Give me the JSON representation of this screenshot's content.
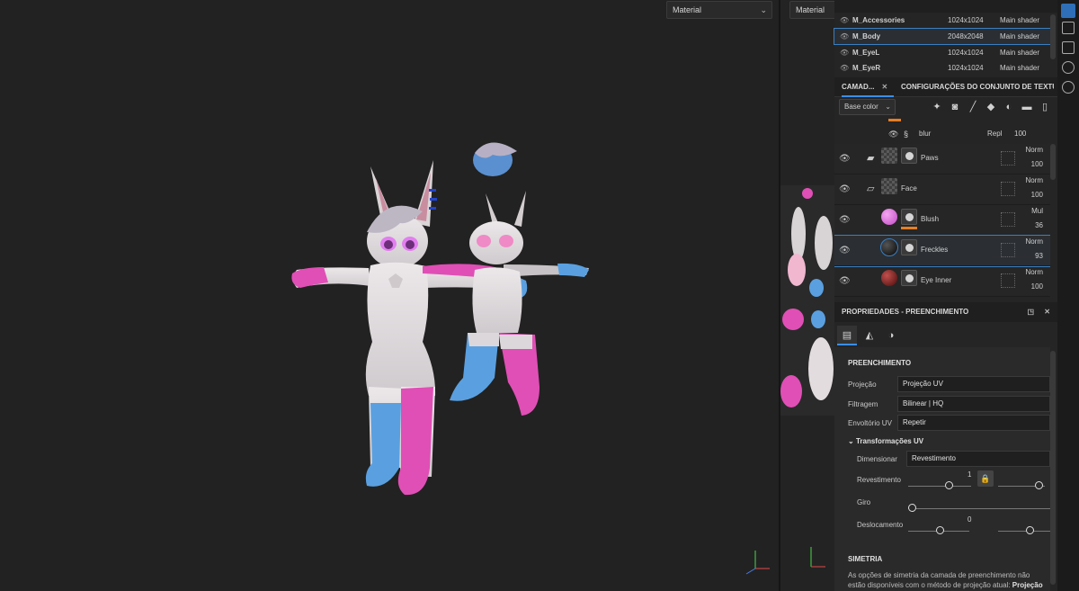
{
  "viewport3d": {
    "material_select": "Material"
  },
  "viewport2d": {
    "material_select": "Material"
  },
  "texture_sets": {
    "rows": [
      {
        "name": "M_Accessories",
        "resolution": "1024x1024",
        "shader": "Main shader",
        "selected": false
      },
      {
        "name": "M_Body",
        "resolution": "2048x2048",
        "shader": "Main shader",
        "selected": true
      },
      {
        "name": "M_EyeL",
        "resolution": "1024x1024",
        "shader": "Main shader",
        "selected": false
      },
      {
        "name": "M_EyeR",
        "resolution": "1024x1024",
        "shader": "Main shader",
        "selected": false
      }
    ]
  },
  "tabs": {
    "layers": "CAMAD...",
    "texture_set_settings": "CONFIGURAÇÕES DO CONJUNTO DE TEXTU..."
  },
  "toolbar": {
    "channel": "Base color"
  },
  "layers": {
    "blur": {
      "name": "blur",
      "blend": "Repl",
      "opacity": "100"
    },
    "items": [
      {
        "name": "Paws",
        "blend": "Norm",
        "opacity": "100",
        "type": "folder"
      },
      {
        "name": "Face",
        "blend": "Norm",
        "opacity": "100",
        "type": "folder-open"
      },
      {
        "name": "Blush",
        "blend": "Mul",
        "opacity": "36",
        "type": "fill",
        "color": "#d35cd6"
      },
      {
        "name": "Freckles",
        "blend": "Norm",
        "opacity": "93",
        "type": "fill",
        "color": "#111111"
      },
      {
        "name": "Eye Inner",
        "blend": "Norm",
        "opacity": "100",
        "type": "fill",
        "color": "#8b1a1a"
      }
    ]
  },
  "properties": {
    "title": "PROPRIEDADES - PREENCHIMENTO",
    "section_fill": "PREENCHIMENTO",
    "projection_label": "Projeção",
    "projection_value": "Projeção UV",
    "filter_label": "Filtragem",
    "filter_value": "Bilinear | HQ",
    "wrap_label": "Envoltório UV",
    "wrap_value": "Repetir",
    "uv_transform_label": "Transformações UV",
    "scale_label": "Dimensionar",
    "scale_value": "Revestimento",
    "tiling_label": "Revestimento",
    "tiling_value": "1",
    "rotation_label": "Giro",
    "offset_label": "Deslocamento",
    "offset_value": "0",
    "section_symmetry": "SIMETRIA",
    "symmetry_note": "As opções de simetria da camada de preenchimento não estão disponíveis com o método de projeção atual:",
    "symmetry_note_bold": "Projeção UV"
  },
  "colors": {
    "accent": "#3a8ee6",
    "selection": "#3a7fc1",
    "pink": "#e04fb5",
    "blue": "#5aa0e0"
  }
}
